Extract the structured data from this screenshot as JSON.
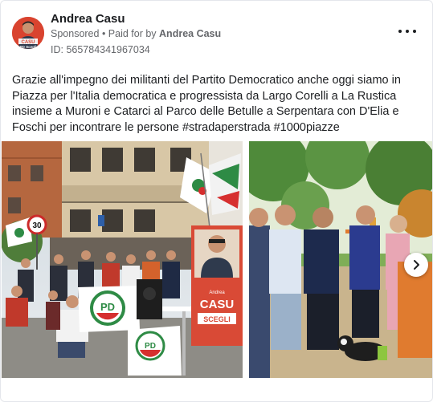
{
  "advertiser": {
    "name": "Andrea Casu",
    "sponsored_label": "Sponsored",
    "paid_for_prefix": " • Paid for by ",
    "paid_for_name": "Andrea Casu",
    "id_line": "ID: 565784341967034",
    "avatar_text_line1": "CASU",
    "avatar_text_line2": "PD Scegli"
  },
  "post": {
    "text": "Grazie all'impegno dei militanti del Partito Democratico anche oggi siamo in Piazza per l'Italia democratica e progressista da Largo Corelli a La Rustica insieme a Muroni e Catarci al Parco delle Betulle a Serpentara con D'Elia e Foschi per incontrare le persone #stradaperstrada #1000piazze"
  },
  "slides": {
    "slide1": {
      "speed_sign": "30",
      "poster_name": "CASU",
      "poster_first": "Andrea",
      "poster_sub": "SCEGLI",
      "pd_logo": "PD",
      "pd_logo_small": "PD"
    }
  },
  "icons": {
    "more": "more-options-icon",
    "next": "chevron-right-icon"
  }
}
